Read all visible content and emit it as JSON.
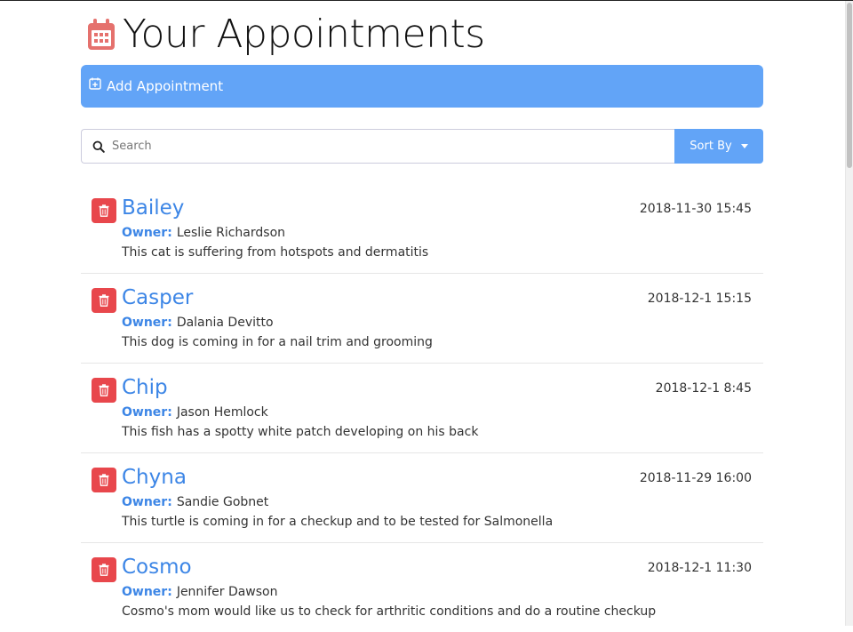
{
  "header": {
    "title": "Your Appointments"
  },
  "add_bar": {
    "label": "Add Appointment"
  },
  "search": {
    "placeholder": "Search",
    "value": ""
  },
  "sort": {
    "label": "Sort By"
  },
  "owner_label": "Owner:",
  "appointments": [
    {
      "pet": "Bailey",
      "owner": "Leslie Richardson",
      "notes": "This cat is suffering from hotspots and dermatitis",
      "date": "2018-11-30 15:45"
    },
    {
      "pet": "Casper",
      "owner": "Dalania Devitto",
      "notes": "This dog is coming in for a nail trim and grooming",
      "date": "2018-12-1 15:15"
    },
    {
      "pet": "Chip",
      "owner": "Jason Hemlock",
      "notes": "This fish has a spotty white patch developing on his back",
      "date": "2018-12-1 8:45"
    },
    {
      "pet": "Chyna",
      "owner": "Sandie Gobnet",
      "notes": "This turtle is coming in for a checkup and to be tested for Salmonella",
      "date": "2018-11-29 16:00"
    },
    {
      "pet": "Cosmo",
      "owner": "Jennifer Dawson",
      "notes": "Cosmo's mom would like us to check for arthritic conditions and do a routine checkup",
      "date": "2018-12-1 11:30"
    }
  ],
  "colors": {
    "primary": "#62a4f7",
    "link": "#3d86e6",
    "danger": "#e8474c",
    "calendar_icon": "#e5716d"
  },
  "icons": {
    "title": "calendar-icon",
    "add": "calendar-plus-icon",
    "search": "search-icon",
    "sort": "caret-down-icon",
    "delete": "trash-icon"
  }
}
